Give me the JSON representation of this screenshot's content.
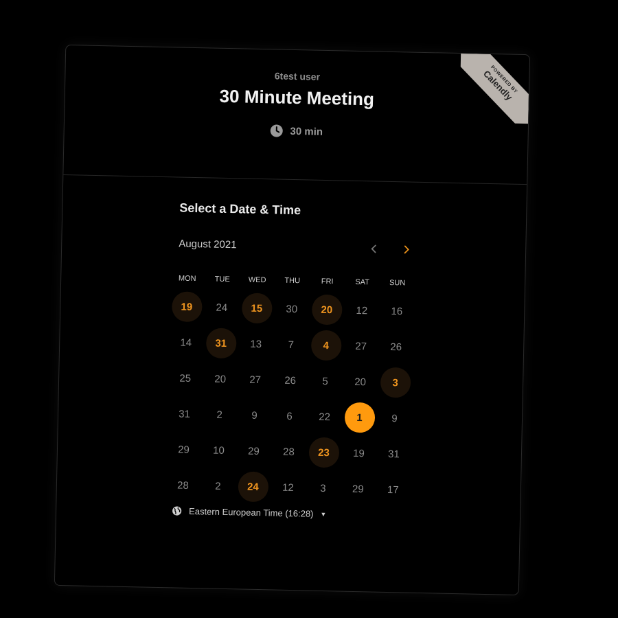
{
  "header": {
    "organizer": "6test user",
    "event_title": "30 Minute Meeting",
    "duration": "30 min"
  },
  "badge": {
    "powered": "POWERED BY",
    "brand": "Calendly"
  },
  "scheduler": {
    "section_title": "Select a Date & Time",
    "month_label": "August 2021",
    "prev_icon": "chevron-left-icon",
    "next_icon": "chevron-right-icon",
    "weekdays": [
      "MON",
      "TUE",
      "WED",
      "THU",
      "FRI",
      "SAT",
      "SUN"
    ],
    "days": [
      {
        "label": "19",
        "state": "available"
      },
      {
        "label": "24",
        "state": "disabled"
      },
      {
        "label": "15",
        "state": "available"
      },
      {
        "label": "30",
        "state": "disabled"
      },
      {
        "label": "20",
        "state": "available"
      },
      {
        "label": "12",
        "state": "disabled"
      },
      {
        "label": "16",
        "state": "disabled"
      },
      {
        "label": "14",
        "state": "disabled"
      },
      {
        "label": "31",
        "state": "available"
      },
      {
        "label": "13",
        "state": "disabled"
      },
      {
        "label": "7",
        "state": "disabled"
      },
      {
        "label": "4",
        "state": "available"
      },
      {
        "label": "27",
        "state": "disabled"
      },
      {
        "label": "26",
        "state": "disabled"
      },
      {
        "label": "25",
        "state": "disabled"
      },
      {
        "label": "20",
        "state": "disabled"
      },
      {
        "label": "27",
        "state": "disabled"
      },
      {
        "label": "26",
        "state": "disabled"
      },
      {
        "label": "5",
        "state": "disabled"
      },
      {
        "label": "20",
        "state": "disabled"
      },
      {
        "label": "3",
        "state": "available"
      },
      {
        "label": "31",
        "state": "disabled"
      },
      {
        "label": "2",
        "state": "disabled"
      },
      {
        "label": "9",
        "state": "disabled"
      },
      {
        "label": "6",
        "state": "disabled"
      },
      {
        "label": "22",
        "state": "disabled"
      },
      {
        "label": "1",
        "state": "selected"
      },
      {
        "label": "9",
        "state": "disabled"
      },
      {
        "label": "29",
        "state": "disabled"
      },
      {
        "label": "10",
        "state": "disabled"
      },
      {
        "label": "29",
        "state": "disabled"
      },
      {
        "label": "28",
        "state": "disabled"
      },
      {
        "label": "23",
        "state": "available"
      },
      {
        "label": "19",
        "state": "disabled"
      },
      {
        "label": "31",
        "state": "disabled"
      },
      {
        "label": "28",
        "state": "disabled"
      },
      {
        "label": "2",
        "state": "disabled"
      },
      {
        "label": "24",
        "state": "available"
      },
      {
        "label": "12",
        "state": "disabled"
      },
      {
        "label": "3",
        "state": "disabled"
      },
      {
        "label": "29",
        "state": "disabled"
      },
      {
        "label": "17",
        "state": "disabled"
      }
    ],
    "timezone_label": "Eastern European Time (16:28)"
  },
  "colors": {
    "accent": "#ff9a0e",
    "available_text": "#f0951f",
    "available_bg": "#1c1208",
    "background": "#000000"
  }
}
